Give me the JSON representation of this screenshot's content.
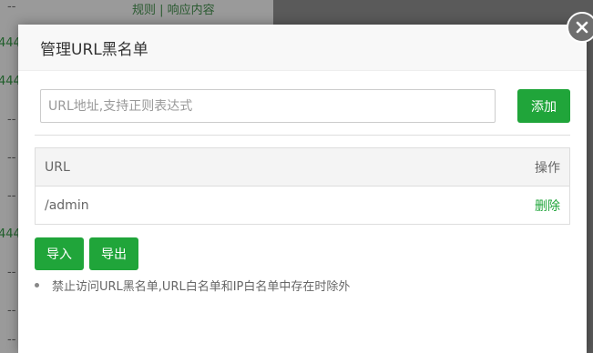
{
  "background": {
    "left_numbers": [
      "444",
      "444",
      "444"
    ],
    "dashes": [
      "--",
      "--",
      "--",
      "--",
      "--",
      "--",
      "--"
    ],
    "top_link": "规则 | 响应内容"
  },
  "modal": {
    "title": "管理URL黑名单",
    "input": {
      "value": "",
      "placeholder": "URL地址,支持正则表达式"
    },
    "add_label": "添加",
    "table": {
      "headers": {
        "url": "URL",
        "action": "操作"
      },
      "rows": [
        {
          "url": "/admin",
          "action": "删除"
        }
      ]
    },
    "import_label": "导入",
    "export_label": "导出",
    "note": "禁止访问URL黑名单,URL白名单和IP白名单中存在时除外"
  },
  "colors": {
    "accent": "#20a53a",
    "close_bg": "#6e6e6e"
  },
  "icons": {
    "close": "close-icon"
  }
}
